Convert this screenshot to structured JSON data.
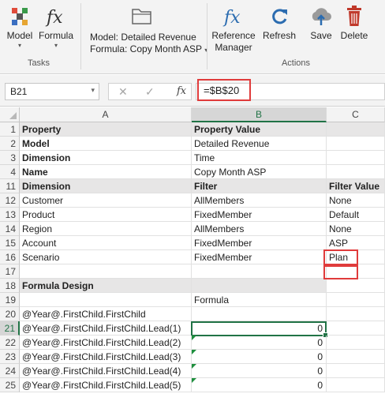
{
  "ribbon": {
    "buttons": [
      {
        "name": "model-button",
        "label": "Model",
        "icon": "model-icon",
        "caret": "▾"
      },
      {
        "name": "formula-button",
        "label": "Formula",
        "icon": "fx-icon",
        "caret": "▾"
      },
      {
        "name": "reference-manager-button",
        "label": "Reference Manager",
        "icon": "fx-icon"
      },
      {
        "name": "refresh-button",
        "label": "Refresh",
        "icon": "refresh-icon"
      },
      {
        "name": "save-button",
        "label": "Save",
        "icon": "cloud-upload-icon"
      },
      {
        "name": "delete-button",
        "label": "Delete",
        "icon": "trash-icon"
      }
    ],
    "model_info": "Model: Detailed Revenue",
    "formula_info": "Formula: Copy Month ASP",
    "formula_caret": "▾",
    "groups": {
      "tasks": "Tasks",
      "actions": "Actions"
    }
  },
  "formula_bar": {
    "name_box": "B21",
    "cancel": "✕",
    "enter": "✓",
    "fx": "fx",
    "value": "=$B$20"
  },
  "grid": {
    "columns": [
      "A",
      "B",
      "C"
    ],
    "selected_column": "B",
    "rows": [
      {
        "n": "1",
        "a": "Property",
        "b": "Property Value",
        "c": "",
        "header": true
      },
      {
        "n": "2",
        "a": "Model",
        "b": "Detailed Revenue",
        "c": ""
      },
      {
        "n": "3",
        "a": "Dimension",
        "b": "Time",
        "c": ""
      },
      {
        "n": "4",
        "a": "Name",
        "b": "Copy Month ASP",
        "c": ""
      },
      {
        "n": "11",
        "a": "Dimension",
        "b": "Filter",
        "c": "Filter Value",
        "header": true
      },
      {
        "n": "12",
        "a": "Customer",
        "b": "AllMembers",
        "c": "None"
      },
      {
        "n": "13",
        "a": "Product",
        "b": "FixedMember",
        "c": "Default"
      },
      {
        "n": "14",
        "a": "Region",
        "b": "AllMembers",
        "c": "None"
      },
      {
        "n": "15",
        "a": "Account",
        "b": "FixedMember",
        "c": "ASP"
      },
      {
        "n": "16",
        "a": "Scenario",
        "b": "FixedMember",
        "c": "Plan"
      },
      {
        "n": "17",
        "a": "",
        "b": "",
        "c": ""
      },
      {
        "n": "18",
        "a": "Formula Design",
        "b": "",
        "c": "",
        "design": true
      },
      {
        "n": "19",
        "a": "",
        "b": "Formula",
        "c": ""
      },
      {
        "n": "20",
        "a": "@Year@.FirstChild.FirstChild",
        "b": "",
        "c": ""
      },
      {
        "n": "21",
        "a": "@Year@.FirstChild.FirstChild.Lead(1)",
        "b": "0",
        "c": "",
        "active": true
      },
      {
        "n": "22",
        "a": "@Year@.FirstChild.FirstChild.Lead(2)",
        "b": "0",
        "c": ""
      },
      {
        "n": "23",
        "a": "@Year@.FirstChild.FirstChild.Lead(3)",
        "b": "0",
        "c": ""
      },
      {
        "n": "24",
        "a": "@Year@.FirstChild.FirstChild.Lead(4)",
        "b": "0",
        "c": ""
      },
      {
        "n": "25",
        "a": "@Year@.FirstChild.FirstChild.Lead(5)",
        "b": "0",
        "c": ""
      }
    ]
  },
  "colors": {
    "accent": "#217346",
    "highlight": "#e03b3b",
    "fx_blue": "#2b6cb0",
    "delete_red": "#c0392b"
  }
}
